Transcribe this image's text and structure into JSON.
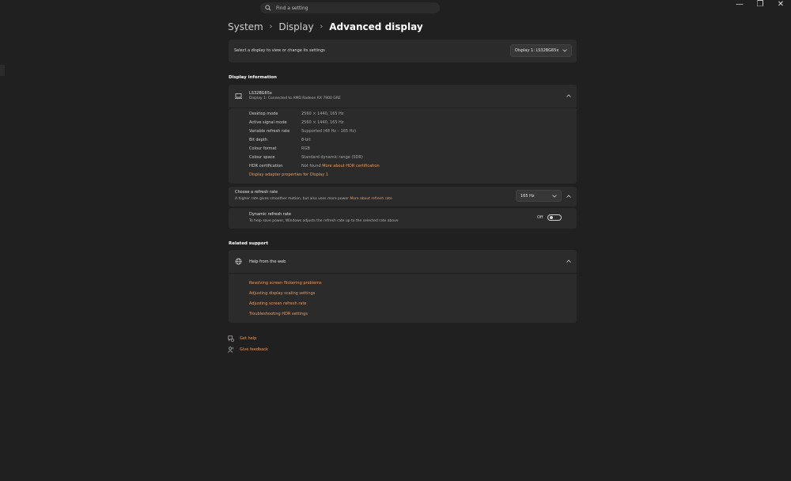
{
  "window": {
    "min_glyph": "—",
    "restore_glyph": "❐",
    "close_glyph": "✕"
  },
  "search": {
    "placeholder": "Find a setting",
    "icon": "search-icon"
  },
  "breadcrumb": {
    "items": [
      "System",
      "Display",
      "Advanced display"
    ],
    "separator": "›"
  },
  "select_display": {
    "label": "Select a display to view or change its settings",
    "value": "Display 1: LS32BG65x"
  },
  "display_info": {
    "section_title": "Display information",
    "monitor_name": "LS32BG65x",
    "monitor_sub": "Display 1: Connected to AMD Radeon RX 7900 GRE",
    "rows": [
      {
        "label": "Desktop mode",
        "value": "2560 × 1440, 165 Hz"
      },
      {
        "label": "Active signal mode",
        "value": "2560 × 1440, 165 Hz"
      },
      {
        "label": "Variable refresh rate",
        "value": "Supported (48 Hz – 165 Hz)"
      },
      {
        "label": "Bit depth",
        "value": "8-bit"
      },
      {
        "label": "Colour format",
        "value": "RGB"
      },
      {
        "label": "Colour space",
        "value": "Standard dynamic range (SDR)"
      },
      {
        "label": "HDR certification",
        "value": "Not found",
        "link": "More about HDR certification"
      }
    ],
    "adapter_link": "Display adapter properties for Display 1"
  },
  "refresh_rate": {
    "title": "Choose a refresh rate",
    "sub": "A higher rate gives smoother motion, but also uses more power",
    "link": "More about refresh rate",
    "value": "165 Hz"
  },
  "dynamic_refresh": {
    "title": "Dynamic refresh rate",
    "sub": "To help save power, Windows adjusts the refresh rate up to the selected rate above",
    "state": "Off"
  },
  "related_support": {
    "section_title": "Related support",
    "help_title": "Help from the web",
    "links": [
      "Resolving screen flickering problems",
      "Adjusting display scaling settings",
      "Adjusting screen refresh rate",
      "Troubleshooting HDR settings"
    ]
  },
  "footer": {
    "get_help": "Get help",
    "give_feedback": "Give feedback"
  },
  "colors": {
    "accent": "#f19a5a",
    "background": "#202020",
    "card": "#2b2b2b"
  }
}
